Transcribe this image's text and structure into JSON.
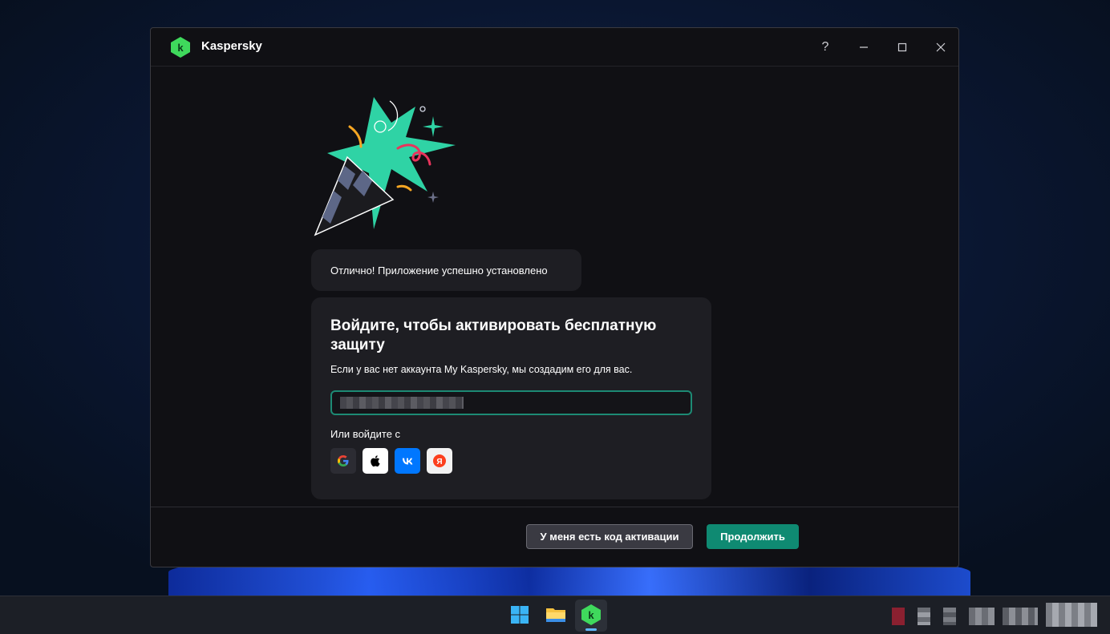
{
  "window": {
    "title": "Kaspersky",
    "controls": {
      "help": "?",
      "minimize": "—",
      "maximize": "☐",
      "close": "✕"
    }
  },
  "notice": "Отлично! Приложение успешно установлено",
  "signin": {
    "title": "Войдите, чтобы активировать бесплатную защиту",
    "subtitle": "Если у вас нет аккаунта My Kaspersky, мы создадим его для вас.",
    "email_value": "",
    "alt_label": "Или войдите с",
    "providers": [
      "google-icon",
      "apple-icon",
      "vk-icon",
      "yandex-icon"
    ]
  },
  "footer": {
    "activation_code_label": "У меня есть код активации",
    "continue_label": "Продолжить"
  },
  "colors": {
    "accent": "#0f8a72",
    "brand_green": "#3fd95c"
  },
  "taskbar": {
    "apps": [
      "windows-start-icon",
      "file-explorer-icon",
      "kaspersky-icon"
    ]
  }
}
